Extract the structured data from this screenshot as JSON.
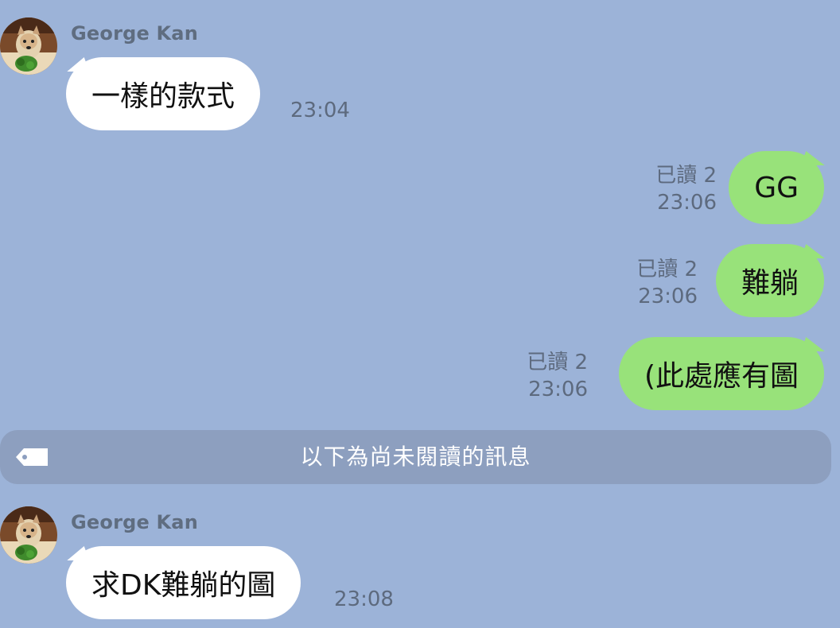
{
  "messages": [
    {
      "sender": "George Kan",
      "text": "一樣的款式",
      "time": "23:04"
    },
    {
      "text": "GG",
      "read": "已讀 2",
      "time": "23:06"
    },
    {
      "text": "難躺",
      "read": "已讀 2",
      "time": "23:06"
    },
    {
      "text": "(此處應有圖",
      "read": "已讀 2",
      "time": "23:06"
    },
    {
      "sender": "George Kan",
      "text": "求DK難躺的圖",
      "time": "23:08"
    }
  ],
  "unread_divider": {
    "label": "以下為尚未閱讀的訊息",
    "icon": "tag-icon"
  },
  "colors": {
    "background": "#9cb3d8",
    "incoming_bubble": "#ffffff",
    "outgoing_bubble": "#98e27a",
    "divider": "#8d9fbf"
  }
}
